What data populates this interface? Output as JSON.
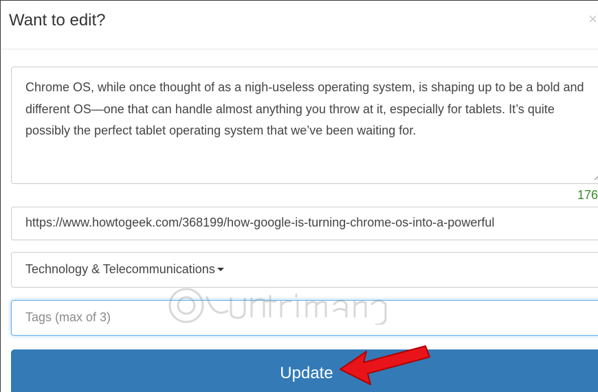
{
  "modal": {
    "title": "Want to edit?",
    "close_label": "×"
  },
  "form": {
    "description": "Chrome OS, while once thought of as a nigh-useless operating system, is shaping up to be a bold and different OS—one that can handle almost anything you throw at it, especially for tablets. It’s quite possibly the perfect tablet operating system that we’ve been waiting for.",
    "char_count": "176",
    "url": "https://www.howtogeek.com/368199/how-google-is-turning-chrome-os-into-a-powerful",
    "category": "Technology & Telecommunications",
    "tags_placeholder": "Tags (max of 3)",
    "submit_label": "Update"
  },
  "colors": {
    "primary": "#337ab7",
    "counter": "#3c8a2e",
    "annotation_arrow": "#e8141a"
  }
}
